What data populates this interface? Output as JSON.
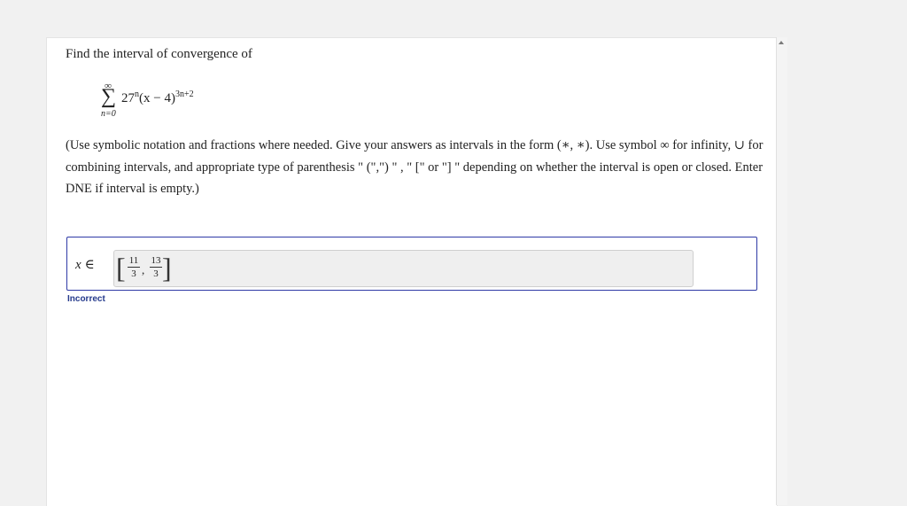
{
  "question": {
    "title": "Find the interval of convergence of",
    "series": {
      "upper_limit": "∞",
      "sigma": "∑",
      "lower_limit": "n=0",
      "base": "27",
      "base_exp": "n",
      "term": "(x − 4)",
      "term_exp": "3n+2"
    },
    "instructions": "(Use symbolic notation and fractions where needed. Give your answers as intervals in the form (∗, ∗). Use symbol ∞ for infinity, ∪ for combining intervals, and appropriate type of parenthesis \" (\",\") \" , \" [\" or \"] \" depending on whether the interval is open or closed. Enter DNE if interval is empty.)"
  },
  "answer": {
    "variable": "x",
    "relation": "∈",
    "open_bracket": "[",
    "lower_num": "11",
    "lower_den": "3",
    "separator": ",",
    "upper_num": "13",
    "upper_den": "3",
    "close_bracket": "]"
  },
  "feedback": {
    "status": "Incorrect"
  },
  "colors": {
    "box_border": "#2f3aa6",
    "status_text": "#253a8c"
  }
}
